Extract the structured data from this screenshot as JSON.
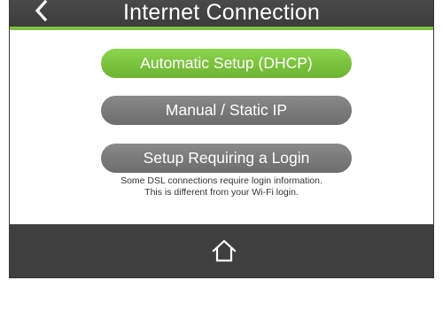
{
  "header": {
    "title": "Internet Connection",
    "back_icon": "chevron-left-icon"
  },
  "options": {
    "automatic": "Automatic Setup (DHCP)",
    "manual": "Manual / Static IP",
    "login": "Setup Requiring a Login"
  },
  "note": {
    "line1": "Some DSL connections require login information.",
    "line2": "This is different from your Wi-Fi login."
  },
  "footer": {
    "home_icon": "home-icon"
  },
  "colors": {
    "accent_green": "#7dc142",
    "header_bg": "#444444",
    "button_gray": "#7a7a7a",
    "footer_bg": "#3f3f3f"
  }
}
